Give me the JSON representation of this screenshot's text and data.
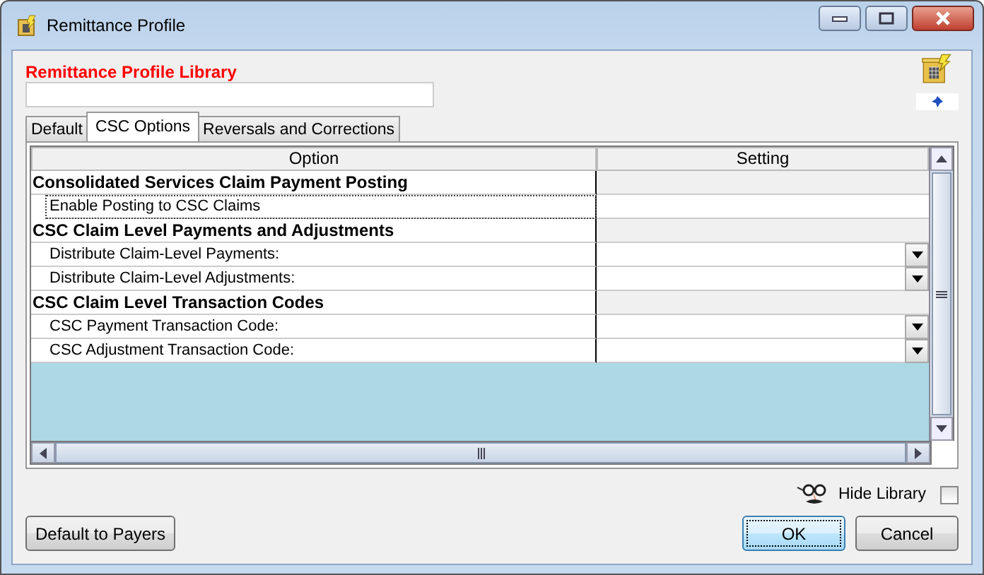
{
  "window": {
    "title": "Remittance Profile"
  },
  "library": {
    "label": "Remittance Profile Library"
  },
  "tabs": [
    {
      "label": "Default",
      "selected": false
    },
    {
      "label": "CSC Options",
      "selected": true
    },
    {
      "label": "Reversals and Corrections",
      "selected": false
    }
  ],
  "table": {
    "columns": [
      "Option",
      "Setting"
    ],
    "rows": [
      {
        "kind": "group",
        "option": "Consolidated Services Claim Payment Posting"
      },
      {
        "kind": "text",
        "option": "Enable Posting to CSC Claims",
        "selected": true
      },
      {
        "kind": "group",
        "option": "CSC Claim Level Payments and Adjustments"
      },
      {
        "kind": "dropdown",
        "option": "Distribute Claim-Level Payments:",
        "selected": false
      },
      {
        "kind": "dropdown",
        "option": "Distribute Claim-Level Adjustments:",
        "selected": false
      },
      {
        "kind": "group",
        "option": "CSC Claim Level Transaction Codes"
      },
      {
        "kind": "dropdown",
        "option": "CSC Payment Transaction Code:",
        "selected": false
      },
      {
        "kind": "dropdown",
        "option": "CSC Adjustment Transaction Code:",
        "selected": false
      }
    ]
  },
  "hide_library": {
    "label": "Hide Library",
    "checked": false
  },
  "buttons": [
    {
      "label": "Default to Payers",
      "kind": "left"
    },
    {
      "label": "OK",
      "kind": "default"
    },
    {
      "label": "Cancel",
      "kind": "plain"
    }
  ]
}
